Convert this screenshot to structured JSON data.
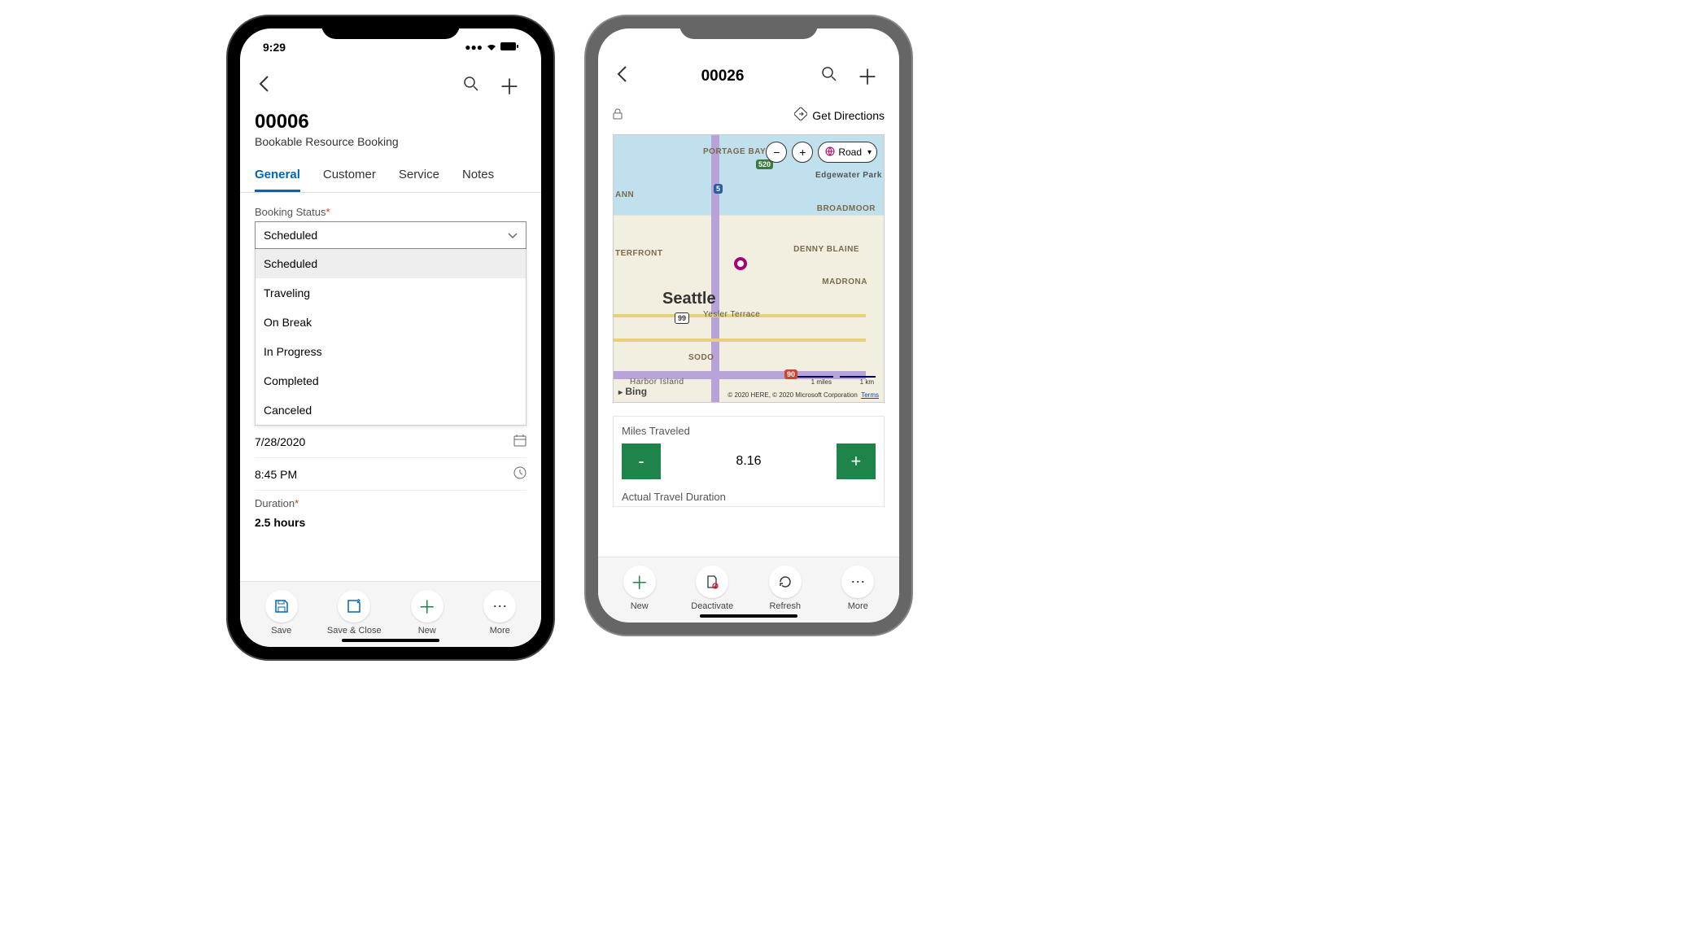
{
  "phone1": {
    "status_time": "9:29",
    "header": {
      "title": "00006",
      "subtitle": "Bookable Resource Booking"
    },
    "tabs": [
      "General",
      "Customer",
      "Service",
      "Notes"
    ],
    "active_tab": "General",
    "booking_status": {
      "label": "Booking Status",
      "required": "*",
      "selected": "Scheduled",
      "options": [
        "Scheduled",
        "Traveling",
        "On Break",
        "In Progress",
        "Completed",
        "Canceled"
      ]
    },
    "date_field": {
      "date": "7/28/2020",
      "time": "8:45 PM"
    },
    "duration": {
      "label": "Duration",
      "required": "*",
      "value": "2.5 hours"
    },
    "bottom": {
      "save": "Save",
      "save_close": "Save & Close",
      "new": "New",
      "more": "More"
    }
  },
  "phone2": {
    "header": {
      "title": "00026"
    },
    "get_directions": "Get Directions",
    "map": {
      "type_selected": "Road",
      "labels": {
        "portage_bay": "PORTAGE BAY",
        "edgewater": "Edgewater Park",
        "broadmoor": "BROADMOOR",
        "denny_blaine": "DENNY BLAINE",
        "madrona": "MADRONA",
        "yesler": "Yesler Terrace",
        "sodo": "SODO",
        "ann": "ANN",
        "terfront": "TERFRONT",
        "harbor": "Harbor Island"
      },
      "city": "Seattle",
      "shields": {
        "i5": "5",
        "sr520": "520",
        "sr99": "99",
        "i90": "90"
      },
      "bing": "Bing",
      "scale": {
        "left": "1 miles",
        "right": "1 km"
      },
      "attrib": "© 2020 HERE, © 2020 Microsoft Corporation",
      "terms": "Terms"
    },
    "miles": {
      "label": "Miles Traveled",
      "value": "8.16",
      "minus": "-",
      "plus": "+"
    },
    "travel_duration": {
      "label": "Actual Travel Duration"
    },
    "bottom": {
      "new": "New",
      "deactivate": "Deactivate",
      "refresh": "Refresh",
      "more": "More"
    }
  }
}
